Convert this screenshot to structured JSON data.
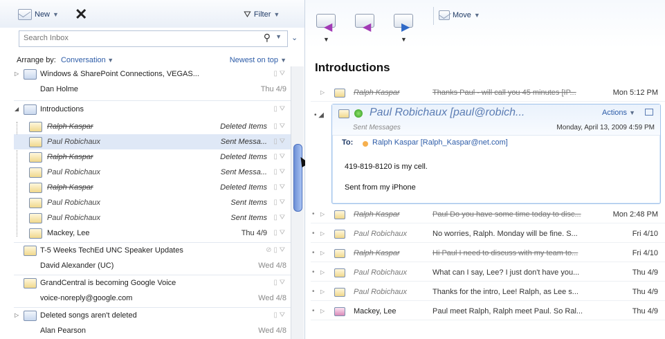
{
  "toolbar": {
    "new_label": "New",
    "filter_label": "Filter"
  },
  "search": {
    "placeholder": "Search Inbox"
  },
  "arrange": {
    "label": "Arrange by:",
    "value": "Conversation",
    "sort": "Newest on top"
  },
  "inbox": [
    {
      "subject": "Windows & SharePoint Connections, VEGAS...",
      "from": "Dan Holme",
      "date": "Thu 4/9"
    },
    {
      "subject": "Introductions"
    },
    {
      "from": "Ralph Kaspar",
      "folder": "Deleted Items"
    },
    {
      "from": "Paul Robichaux",
      "folder": "Sent Messa..."
    },
    {
      "from": "Ralph Kaspar",
      "folder": "Deleted Items"
    },
    {
      "from": "Paul Robichaux",
      "folder": "Sent Messa..."
    },
    {
      "from": "Ralph Kaspar",
      "folder": "Deleted Items"
    },
    {
      "from": "Paul Robichaux",
      "folder": "Sent Items"
    },
    {
      "from": "Paul Robichaux",
      "folder": "Sent Items"
    },
    {
      "from": "Mackey, Lee",
      "folder": "Thu 4/9"
    },
    {
      "subject": "T-5 Weeks TechEd UNC Speaker Updates",
      "from": "David Alexander (UC)",
      "date": "Wed 4/8"
    },
    {
      "subject": "GrandCentral is becoming Google Voice",
      "from": "voice-noreply@google.com",
      "date": "Wed 4/8"
    },
    {
      "subject": "Deleted songs aren't deleted",
      "from": "Alan Pearson",
      "date": "Wed 4/8"
    }
  ],
  "right_toolbar": {
    "move_label": "Move"
  },
  "conversation": {
    "title": "Introductions",
    "first": {
      "from": "Ralph Kaspar",
      "preview": "Thanks Paul - will call you 45 minutes [IP...",
      "date": "Mon 5:12 PM"
    },
    "expanded": {
      "from": "Paul Robichaux [paul@robich...",
      "actions": "Actions",
      "folder": "Sent Messages",
      "when": "Monday, April 13, 2009 4:59 PM",
      "to_label": "To:",
      "to_value": "Ralph Kaspar [Ralph_Kaspar@net.com]",
      "body_line1": "419-819-8120 is my cell.",
      "body_line2": "Sent from my iPhone"
    },
    "messages": [
      {
        "from": "Ralph Kaspar",
        "preview": "Paul Do you have some time today to disc...",
        "date": "Mon 2:48 PM"
      },
      {
        "from": "Paul Robichaux",
        "preview": "No worries, Ralph. Monday will be fine. S...",
        "date": "Fri 4/10"
      },
      {
        "from": "Ralph Kaspar",
        "preview": "Hi Paul I need to discuss with my team to...",
        "date": "Fri 4/10"
      },
      {
        "from": "Paul Robichaux",
        "preview": "What can I say, Lee? I just don't have you...",
        "date": "Thu 4/9"
      },
      {
        "from": "Paul Robichaux",
        "preview": "Thanks for the intro, Lee! Ralph, as Lee s...",
        "date": "Thu 4/9"
      },
      {
        "from": "Mackey, Lee",
        "preview": "Paul meet Ralph, Ralph meet Paul. So Ral...",
        "date": "Thu 4/9"
      }
    ]
  }
}
